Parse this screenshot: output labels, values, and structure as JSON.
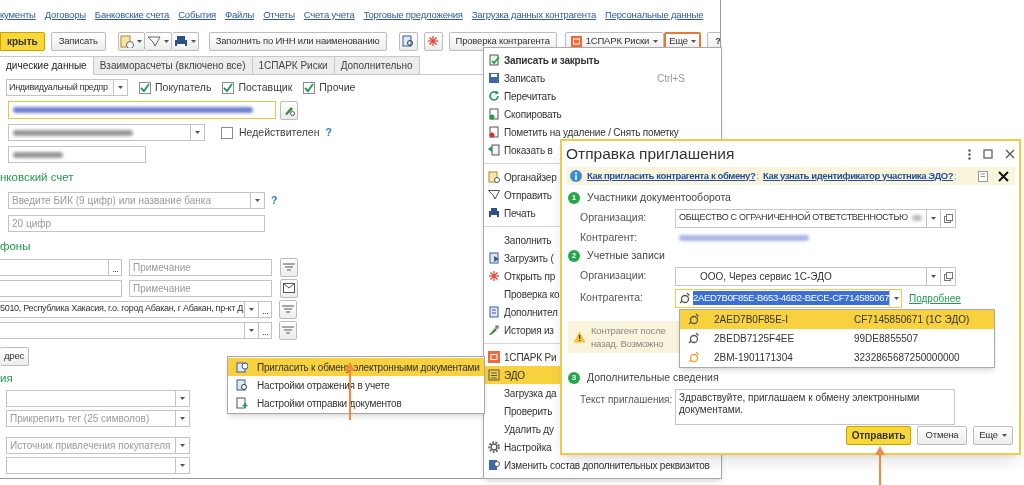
{
  "nav_links": [
    "кументы",
    "Договоры",
    "Банковские счета",
    "События",
    "Файлы",
    "Отчеты",
    "Счета учета",
    "Торговые предложения",
    "Загрузка данных контрагента",
    "Персональные данные"
  ],
  "toolbar": {
    "save_close": "крыть",
    "save": "Записать",
    "fill_by_inn": "Заполнить по ИНН или наименованию",
    "check": "Проверка контрагента",
    "spark": "1СПАРК Риски",
    "more": "Еще",
    "more_highlighted": true,
    "help": "?"
  },
  "tabs": [
    {
      "label": "дические данные",
      "selected": true
    },
    {
      "label": "Взаиморасчеты (включено все)",
      "selected": false
    },
    {
      "label": "1СПАРК Риски",
      "selected": false
    },
    {
      "label": "Дополнительно",
      "selected": false
    }
  ],
  "form": {
    "type": "Индивидуальный предпр",
    "roles": [
      {
        "label": "Покупатель",
        "checked": true
      },
      {
        "label": "Поставщик",
        "checked": true
      },
      {
        "label": "Прочие",
        "checked": true
      }
    ],
    "inactive": {
      "label": "Недействителен",
      "checked": false
    },
    "inactive_help": "?",
    "bank_heading": "нковский счет",
    "bik_placeholder": "Введите БИК (9 цифр) или название банка",
    "bik_help": "?",
    "account_placeholder": "20 цифр",
    "phones_heading": "фоны",
    "contacts": [
      {
        "kind": "phone",
        "note_placeholder": "Примечание"
      },
      {
        "kind": "email",
        "note_placeholder": "Примечание"
      },
      {
        "kind": "address",
        "value": "5010, Республика Хакасия, г.о. город Абакан, г Абакан, пр-кт Д"
      },
      {
        "kind": "address"
      }
    ],
    "address_button": "дрес",
    "extra_heading": "ия",
    "selects": [
      {
        "kind": "empty"
      },
      {
        "kind": "placeholder",
        "placeholder": "Прикрепить тег (25 символов)"
      },
      {
        "kind": "placeholder",
        "placeholder": "Источник привлечения покупателя"
      },
      {
        "kind": "empty"
      }
    ]
  },
  "more_menu": {
    "items": [
      {
        "kind": "item",
        "label": "Записать и закрыть",
        "bold": true,
        "selected": false
      },
      {
        "kind": "item",
        "label": "Записать",
        "shortcut": "Ctrl+S",
        "bold": false,
        "selected": false
      },
      {
        "kind": "item",
        "label": "Перечитать",
        "bold": false,
        "selected": false
      },
      {
        "kind": "item",
        "label": "Скопировать",
        "bold": false,
        "selected": false
      },
      {
        "kind": "item",
        "label": "Пометить на удаление / Снять пометку",
        "bold": false,
        "selected": false
      },
      {
        "kind": "item",
        "label": "Показать в",
        "bold": false,
        "selected": false
      },
      {
        "kind": "separator"
      },
      {
        "kind": "item",
        "label": "Органайзер",
        "bold": false,
        "selected": false
      },
      {
        "kind": "item",
        "label": "Отправить",
        "bold": false,
        "selected": false
      },
      {
        "kind": "item",
        "label": "Печать",
        "bold": false,
        "selected": false
      },
      {
        "kind": "separator"
      },
      {
        "kind": "item",
        "label": "Заполнить",
        "bold": false,
        "selected": false
      },
      {
        "kind": "item",
        "label": "Загрузить (",
        "bold": false,
        "selected": false
      },
      {
        "kind": "item",
        "label": "Открыть пр",
        "bold": false,
        "selected": false
      },
      {
        "kind": "item",
        "label": "Проверка ко",
        "bold": false,
        "selected": false
      },
      {
        "kind": "item",
        "label": "Дополнител",
        "bold": false,
        "selected": false
      },
      {
        "kind": "item",
        "label": "История из",
        "bold": false,
        "selected": false
      },
      {
        "kind": "separator"
      },
      {
        "kind": "item",
        "label": "1СПАРК Ри",
        "bold": false,
        "selected": false
      },
      {
        "kind": "item",
        "label": "ЭДО",
        "bold": false,
        "selected": true
      },
      {
        "kind": "item",
        "label": "Загрузка да",
        "bold": false,
        "selected": false
      },
      {
        "kind": "item",
        "label": "Проверить",
        "bold": false,
        "selected": false
      },
      {
        "kind": "item",
        "label": "Удалить ду",
        "bold": false,
        "selected": false
      },
      {
        "kind": "item",
        "label": "Настройка",
        "bold": false,
        "selected": false
      },
      {
        "kind": "item",
        "label": "Изменить состав дополнительных реквизитов",
        "bold": false,
        "selected": false
      }
    ]
  },
  "submenu": [
    {
      "label": "Пригласить к обмену электронными документами",
      "selected": true
    },
    {
      "label": "Настройки отражения в учете",
      "selected": false
    },
    {
      "label": "Настройки отправки документов",
      "selected": false
    }
  ],
  "dialog": {
    "title": "Отправка приглашения",
    "info_links": [
      "Как пригласить контрагента к обмену?",
      "Как узнать идентификатор участника ЭДО?"
    ],
    "link_separator": ";",
    "sections": [
      {
        "number": "1",
        "title": "Участники документооборота"
      },
      {
        "number": "2",
        "title": "Учетные записи"
      },
      {
        "number": "3",
        "title": "Дополнительные сведения"
      }
    ],
    "organization": {
      "label": "Организация:",
      "value": "ОБЩЕСТВО С ОГРАНИЧЕННОЙ ОТВЕТСТВЕННОСТЬЮ"
    },
    "counterparty": {
      "label": "Контрагент:"
    },
    "org_account": {
      "label": "Организации:",
      "value": "ООО, Через сервис 1С-ЭДО"
    },
    "counterparty_account": {
      "label": "Контрагента:",
      "value": "2AED7B0F85E-B653-46B2-BECE-CF714585067",
      "details_link": "Подробнее"
    },
    "account_options": [
      {
        "id_start": "2AED7B0F85E-I",
        "id_end": "CF7145850671 (1С ЭДО)",
        "selected": true,
        "color": "#555555"
      },
      {
        "id_start": "2BEDB7125F4EE",
        "id_end": "99DE8855507",
        "selected": false,
        "color": "#555555"
      },
      {
        "id_start": "2BM-1901171304",
        "id_end": "3232865687250000000",
        "selected": false,
        "color": "#f0a030"
      }
    ],
    "warning_lines": [
      "Контрагент после",
      "назад. Возможно"
    ],
    "invitation_label": "Текст приглашения:",
    "invitation_text": "Здравствуйте, приглашаем к обмену электронными документами.",
    "buttons": {
      "send": "Отправить",
      "cancel": "Отмена",
      "more": "Еще"
    }
  }
}
